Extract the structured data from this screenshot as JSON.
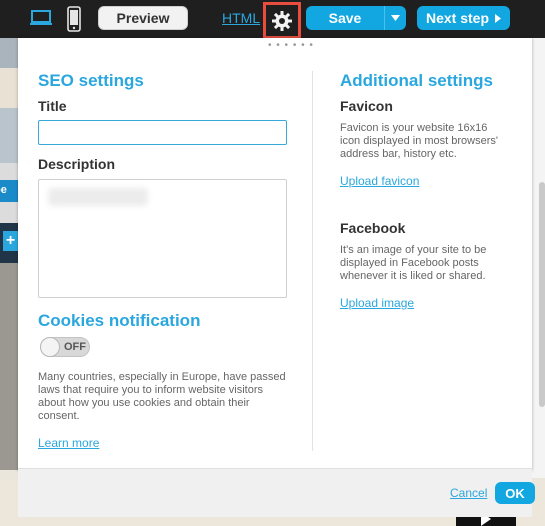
{
  "toolbar": {
    "preview_label": "Preview",
    "html_label": "HTML",
    "save_label": "Save",
    "next_step_label": "Next step",
    "icons": {
      "desktop": "desktop-icon",
      "mobile": "mobile-icon",
      "settings": "gear-icon",
      "save_dropdown": "chevron-down-icon",
      "next": "triangle-right-icon"
    },
    "accent_color": "#12a7e0",
    "highlight_color": "#e84d3d"
  },
  "background": {
    "tag_text": "be",
    "plus_text": "+"
  },
  "modal": {
    "drag_handle": "• • • • • •",
    "seo": {
      "heading": "SEO settings",
      "title_label": "Title",
      "title_value": "",
      "description_label": "Description",
      "description_value": ""
    },
    "cookies": {
      "heading": "Cookies notification",
      "toggle_state": "OFF",
      "text": "Many countries, especially in Europe, have passed laws that require you to inform website visitors about how you use cookies and obtain their consent.",
      "link": "Learn more"
    },
    "additional": {
      "heading": "Additional settings",
      "favicon_label": "Favicon",
      "favicon_text": "Favicon is your website 16x16 icon displayed in most browsers' address bar, history etc.",
      "favicon_link": "Upload favicon",
      "facebook_label": "Facebook",
      "facebook_text": "It's an image of your site to be displayed in Facebook posts whenever it is liked or shared.",
      "facebook_link": "Upload image"
    },
    "footer": {
      "cancel_label": "Cancel",
      "ok_label": "OK"
    }
  }
}
